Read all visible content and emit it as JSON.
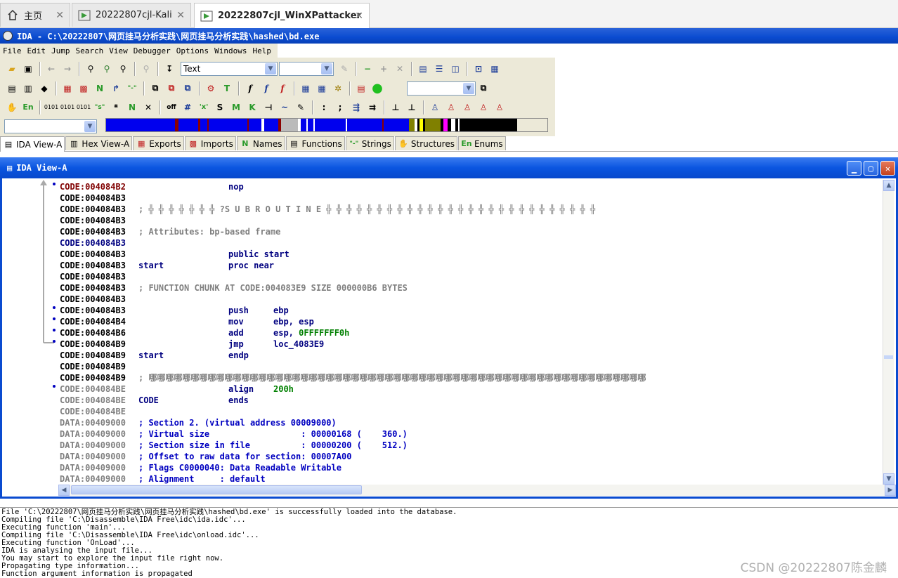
{
  "vm_tabs": [
    {
      "label": "主页",
      "icon": "home-icon"
    },
    {
      "label": "20222807cjl-Kali",
      "icon": "vm-icon"
    },
    {
      "label": "20222807cjl_WinXPattacker",
      "icon": "vm-icon"
    }
  ],
  "window_title": "IDA - C:\\20222807\\网页挂马分析实践\\网页挂马分析实践\\hashed\\bd.exe",
  "menu": [
    "File",
    "Edit",
    "Jump",
    "Search",
    "View",
    "Debugger",
    "Options",
    "Windows",
    "Help"
  ],
  "toolbar": {
    "text_combo": "Text",
    "combo2": "",
    "combo3": "",
    "nav_combo": ""
  },
  "panel_tabs": [
    "IDA View-A",
    "Hex View-A",
    "Exports",
    "Imports",
    "Names",
    "Functions",
    "Strings",
    "Structures",
    "Enums"
  ],
  "ida_view_title": "IDA View-A",
  "listing": [
    {
      "seg": "CODE:004084B2",
      "segColor": "red",
      "label": "",
      "mnem": "nop",
      "ops": "",
      "dot": true
    },
    {
      "seg": "CODE:004084B3",
      "segColor": "black",
      "label": "",
      "mnem": "",
      "ops": ""
    },
    {
      "seg": "CODE:004084B3",
      "segColor": "black",
      "comment": "; ╬ ╬ ╬ ╬ ╬ ╬ ╬ ?S U B R O U T I N E ╬ ╬ ╬ ╬ ╬ ╬ ╬ ╬ ╬ ╬ ╬ ╬ ╬ ╬ ╬ ╬ ╬ ╬ ╬ ╬ ╬ ╬ ╬ ╬ ╬ ╬ ╬"
    },
    {
      "seg": "CODE:004084B3",
      "segColor": "black"
    },
    {
      "seg": "CODE:004084B3",
      "segColor": "black",
      "comment": "; Attributes: bp-based frame"
    },
    {
      "seg": "CODE:004084B3",
      "segColor": "navy"
    },
    {
      "seg": "CODE:004084B3",
      "segColor": "black",
      "label": "",
      "mnem": "public start",
      "ops": ""
    },
    {
      "seg": "CODE:004084B3",
      "segColor": "black",
      "label": "start",
      "mnem": "proc near",
      "ops": ""
    },
    {
      "seg": "CODE:004084B3",
      "segColor": "black"
    },
    {
      "seg": "CODE:004084B3",
      "segColor": "black",
      "comment": "; FUNCTION CHUNK AT CODE:004083E9 SIZE 000000B6 BYTES"
    },
    {
      "seg": "CODE:004084B3",
      "segColor": "black"
    },
    {
      "seg": "CODE:004084B3",
      "segColor": "black",
      "mnem": "push",
      "ops": "ebp",
      "dot": true
    },
    {
      "seg": "CODE:004084B4",
      "segColor": "black",
      "mnem": "mov",
      "ops": "ebp, esp",
      "dot": true
    },
    {
      "seg": "CODE:004084B6",
      "segColor": "black",
      "mnem": "add",
      "ops": "esp, ",
      "ops2": "0FFFFFFF0h",
      "dot": true
    },
    {
      "seg": "CODE:004084B9",
      "segColor": "black",
      "mnem": "jmp",
      "ops": "loc_4083E9",
      "dot": true
    },
    {
      "seg": "CODE:004084B9",
      "segColor": "black",
      "label": "start",
      "mnem": "endp",
      "ops": ""
    },
    {
      "seg": "CODE:004084B9",
      "segColor": "black"
    },
    {
      "seg": "CODE:004084B9",
      "segColor": "black",
      "comment": "; 哪哪哪哪哪哪哪哪哪哪哪哪哪哪哪哪哪哪哪哪哪哪哪哪哪哪哪哪哪哪哪哪哪哪哪哪哪哪哪哪哪哪哪哪哪哪哪哪哪哪哪哪哪哪哪哪哪哪哪"
    },
    {
      "seg": "CODE:004084BE",
      "segColor": "grey",
      "mnem": "align",
      "ops": "",
      "ops2": "200h",
      "dot": true
    },
    {
      "seg": "CODE:004084BE",
      "segColor": "grey",
      "label": "CODE",
      "mnem": "ends",
      "ops": ""
    },
    {
      "seg": "CODE:004084BE",
      "segColor": "grey"
    },
    {
      "seg": "DATA:00409000",
      "segColor": "grey",
      "comment2": "; Section 2. (virtual address 00009000)"
    },
    {
      "seg": "DATA:00409000",
      "segColor": "grey",
      "comment2": "; Virtual size                  : 00000168 (    360.)"
    },
    {
      "seg": "DATA:00409000",
      "segColor": "grey",
      "comment2": "; Section size in file          : 00000200 (    512.)"
    },
    {
      "seg": "DATA:00409000",
      "segColor": "grey",
      "comment2": "; Offset to raw data for section: 00007A00"
    },
    {
      "seg": "DATA:00409000",
      "segColor": "grey",
      "comment2": "; Flags C0000040: Data Readable Writable"
    },
    {
      "seg": "DATA:00409000",
      "segColor": "grey",
      "comment2": "; Alignment     : default"
    }
  ],
  "output": [
    "File 'C:\\20222807\\网页挂马分析实践\\网页挂马分析实践\\hashed\\bd.exe' is successfully loaded into the database.",
    "Compiling file 'C:\\Disassemble\\IDA Free\\idc\\ida.idc'...",
    "Executing function 'main'...",
    "Compiling file 'C:\\Disassemble\\IDA Free\\idc\\onload.idc'...",
    "Executing function 'OnLoad'...",
    "IDA is analysing the input file...",
    "You may start to explore the input file right now.",
    "Propagating type information...",
    "Function argument information is propagated"
  ],
  "watermark": "CSDN @20222807陈金麟",
  "colors": {
    "title_blue": "#0a4bd0",
    "seg_red": "#800000",
    "code_navy": "#000080"
  }
}
